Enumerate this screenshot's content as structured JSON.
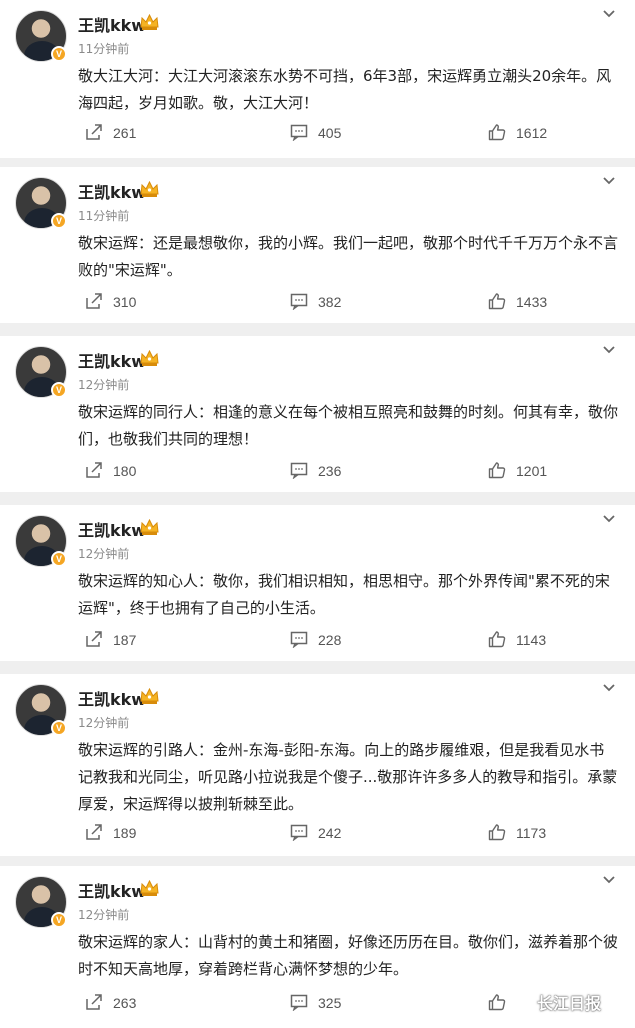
{
  "username": "王凯kkw",
  "verified_badge": "V",
  "icons": {
    "crown": "crown-icon",
    "share": "share-icon",
    "comment": "comment-icon",
    "like": "like-icon",
    "more": "chevron-down-icon"
  },
  "colors": {
    "accent": "#f5a623",
    "background": "#efefef",
    "card": "#ffffff"
  },
  "posts": [
    {
      "time": "11分钟前",
      "lines": [
        "敬大江大河：大江大河滚滚东水势不可挡，6年3部，宋运辉勇立潮头20余年。风",
        "海四起，岁月如歌。敬，大江大河！"
      ],
      "shares": "261",
      "comments": "405",
      "likes": "1612"
    },
    {
      "time": "11分钟前",
      "lines": [
        "敬宋运辉：还是最想敬你，我的小辉。我们一起吧，敬那个时代千千万万个永不言",
        "败的\"宋运辉\"。"
      ],
      "shares": "310",
      "comments": "382",
      "likes": "1433"
    },
    {
      "time": "12分钟前",
      "lines": [
        "敬宋运辉的同行人：相逢的意义在每个被相互照亮和鼓舞的时刻。何其有幸，敬你",
        "们，也敬我们共同的理想！"
      ],
      "shares": "180",
      "comments": "236",
      "likes": "1201"
    },
    {
      "time": "12分钟前",
      "lines": [
        "敬宋运辉的知心人：敬你，我们相识相知，相思相守。那个外界传闻\"累不死的宋",
        "运辉\"，终于也拥有了自己的小生活。"
      ],
      "shares": "187",
      "comments": "228",
      "likes": "1143"
    },
    {
      "time": "12分钟前",
      "lines": [
        "敬宋运辉的引路人：金州-东海-彭阳-东海。向上的路步履维艰，但是我看见水书",
        "记教我和光同尘，听见路小拉说我是个傻子...敬那许许多多人的教导和指引。承蒙",
        "厚爱，宋运辉得以披荆斩棘至此。"
      ],
      "shares": "189",
      "comments": "242",
      "likes": "1173"
    },
    {
      "time": "12分钟前",
      "lines": [
        "敬宋运辉的家人：山背村的黄土和猪圈，好像还历历在目。敬你们，滋养着那个彼",
        "时不知天高地厚，穿着跨栏背心满怀梦想的少年。"
      ],
      "shares": "263",
      "comments": "325",
      "likes": ""
    }
  ],
  "watermark": {
    "text": "长江日报"
  }
}
